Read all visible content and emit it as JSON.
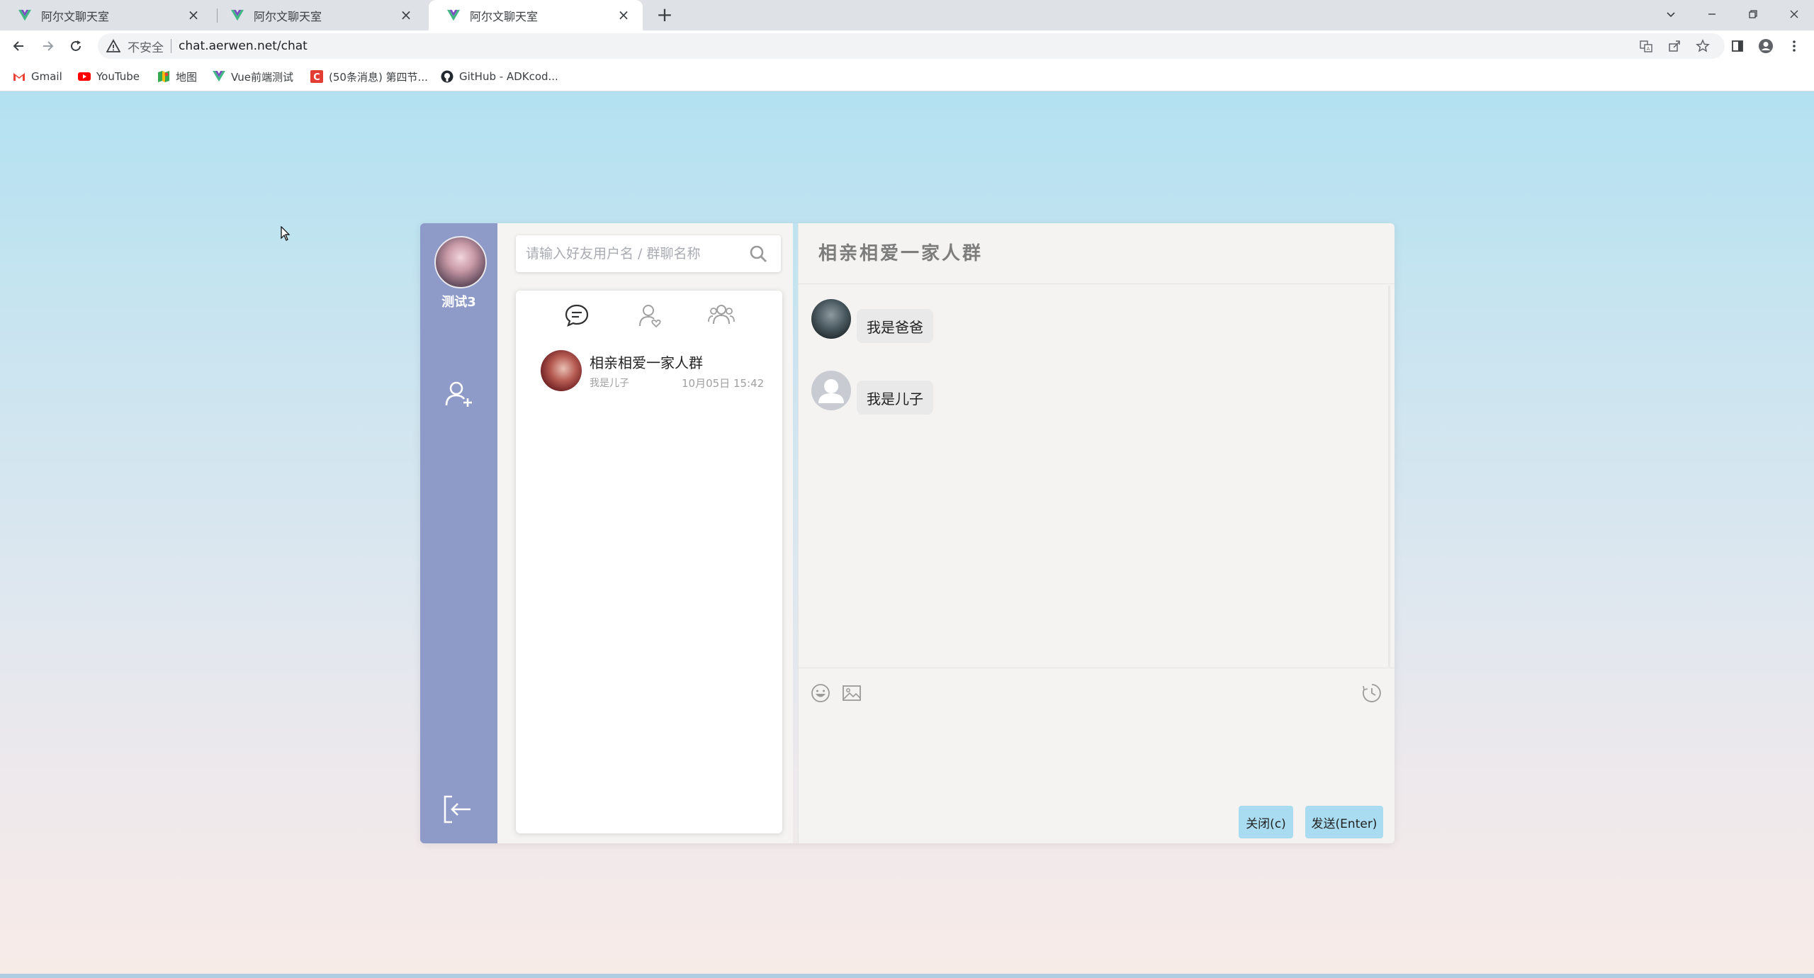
{
  "browser": {
    "tabs": [
      {
        "title": "阿尔文聊天室",
        "active": false
      },
      {
        "title": "阿尔文聊天室",
        "active": false
      },
      {
        "title": "阿尔文聊天室",
        "active": true
      }
    ],
    "address": {
      "security_label": "不安全",
      "url": "chat.aerwen.net/chat"
    },
    "bookmarks": [
      {
        "label": "Gmail",
        "icon": "gmail-icon"
      },
      {
        "label": "YouTube",
        "icon": "youtube-icon"
      },
      {
        "label": "地图",
        "icon": "maps-icon"
      },
      {
        "label": "Vue前端测试",
        "icon": "vue-icon"
      },
      {
        "label": "(50条消息) 第四节...",
        "icon": "csdn-icon"
      },
      {
        "label": "GitHub - ADKcod...",
        "icon": "github-icon"
      }
    ]
  },
  "user": {
    "name": "测试3"
  },
  "search": {
    "placeholder": "请输入好友用户名 / 群聊名称",
    "value": ""
  },
  "conversations": [
    {
      "name": "相亲相爱一家人群",
      "last_message": "我是儿子",
      "time": "10月05日 15:42"
    }
  ],
  "chat": {
    "title": "相亲相爱一家人群",
    "messages": [
      {
        "text": "我是爸爸",
        "avatar": "photo"
      },
      {
        "text": "我是儿子",
        "avatar": "default"
      }
    ],
    "input_value": "",
    "close_label": "关闭(c)",
    "send_label": "发送(Enter)"
  },
  "colors": {
    "sidebar": "#8e9ac8",
    "button": "#a9dcf0",
    "bubble": "#e9e9e9"
  }
}
